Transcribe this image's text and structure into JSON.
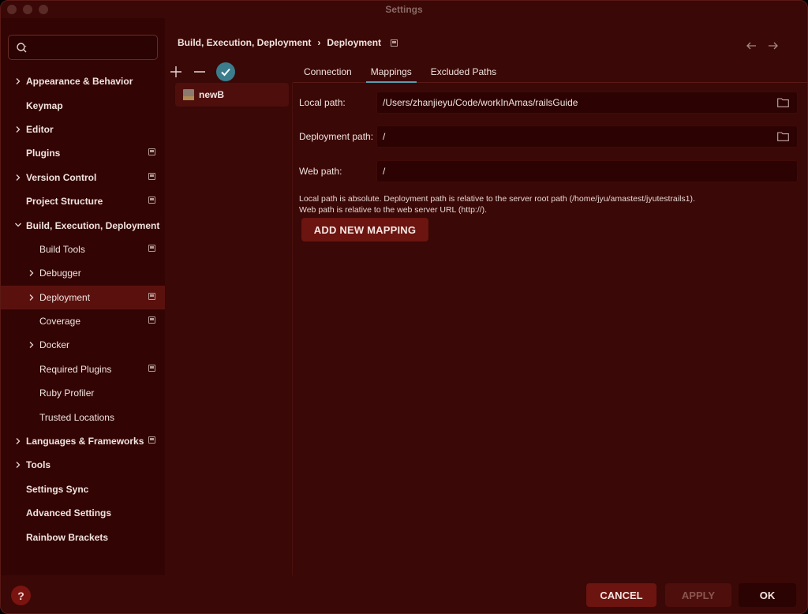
{
  "window": {
    "title": "Settings"
  },
  "search": {
    "placeholder": ""
  },
  "sidebar": {
    "items": [
      {
        "label": "Appearance & Behavior",
        "bold": true,
        "level": 0,
        "chevron": "right",
        "pin": false
      },
      {
        "label": "Keymap",
        "bold": true,
        "level": 0,
        "chevron": "none",
        "pin": false
      },
      {
        "label": "Editor",
        "bold": true,
        "level": 0,
        "chevron": "right",
        "pin": false
      },
      {
        "label": "Plugins",
        "bold": true,
        "level": 0,
        "chevron": "none",
        "pin": true
      },
      {
        "label": "Version Control",
        "bold": true,
        "level": 0,
        "chevron": "right",
        "pin": true
      },
      {
        "label": "Project Structure",
        "bold": true,
        "level": 0,
        "chevron": "none",
        "pin": true
      },
      {
        "label": "Build, Execution, Deployment",
        "bold": true,
        "level": 0,
        "chevron": "down",
        "pin": false
      },
      {
        "label": "Build Tools",
        "bold": false,
        "level": 1,
        "chevron": "none",
        "pin": true
      },
      {
        "label": "Debugger",
        "bold": false,
        "level": 1,
        "chevron": "right",
        "pin": false
      },
      {
        "label": "Deployment",
        "bold": false,
        "level": 1,
        "chevron": "right",
        "pin": true,
        "selected": true
      },
      {
        "label": "Coverage",
        "bold": false,
        "level": 1,
        "chevron": "none",
        "pin": true
      },
      {
        "label": "Docker",
        "bold": false,
        "level": 1,
        "chevron": "right",
        "pin": false
      },
      {
        "label": "Required Plugins",
        "bold": false,
        "level": 1,
        "chevron": "none",
        "pin": true
      },
      {
        "label": "Ruby Profiler",
        "bold": false,
        "level": 1,
        "chevron": "none",
        "pin": false
      },
      {
        "label": "Trusted Locations",
        "bold": false,
        "level": 1,
        "chevron": "none",
        "pin": false
      },
      {
        "label": "Languages & Frameworks",
        "bold": true,
        "level": 0,
        "chevron": "right",
        "pin": true
      },
      {
        "label": "Tools",
        "bold": true,
        "level": 0,
        "chevron": "right",
        "pin": false
      },
      {
        "label": "Settings Sync",
        "bold": true,
        "level": 0,
        "chevron": "none",
        "pin": false
      },
      {
        "label": "Advanced Settings",
        "bold": true,
        "level": 0,
        "chevron": "none",
        "pin": false
      },
      {
        "label": "Rainbow Brackets",
        "bold": true,
        "level": 0,
        "chevron": "none",
        "pin": false
      }
    ]
  },
  "breadcrumb": {
    "parent": "Build, Execution, Deployment",
    "separator": "›",
    "current": "Deployment"
  },
  "servers": {
    "items": [
      {
        "name": "newB",
        "icon": "ftp-server-icon"
      }
    ]
  },
  "tabs": [
    {
      "label": "Connection",
      "active": false
    },
    {
      "label": "Mappings",
      "active": true
    },
    {
      "label": "Excluded Paths",
      "active": false
    }
  ],
  "form": {
    "local_path_label": "Local path:",
    "local_path_value": "/Users/zhanjieyu/Code/workInAmas/railsGuide",
    "deployment_path_label": "Deployment path:",
    "deployment_path_value": "/",
    "web_path_label": "Web path:",
    "web_path_value": "/",
    "hint_line1": "Local path is absolute. Deployment path is relative to the server root path (/home/jyu/amastest/jyutestrails1).",
    "hint_line2": "Web path is relative to the web server URL (http://).",
    "add_mapping_label": "ADD NEW MAPPING"
  },
  "footer": {
    "help_label": "?",
    "cancel_label": "CANCEL",
    "apply_label": "APPLY",
    "ok_label": "OK"
  },
  "colors": {
    "background": "#3a0806",
    "accent_button": "#6b1410",
    "active_tab_underline": "#5a9db0",
    "check_button": "#3b7d8c"
  }
}
